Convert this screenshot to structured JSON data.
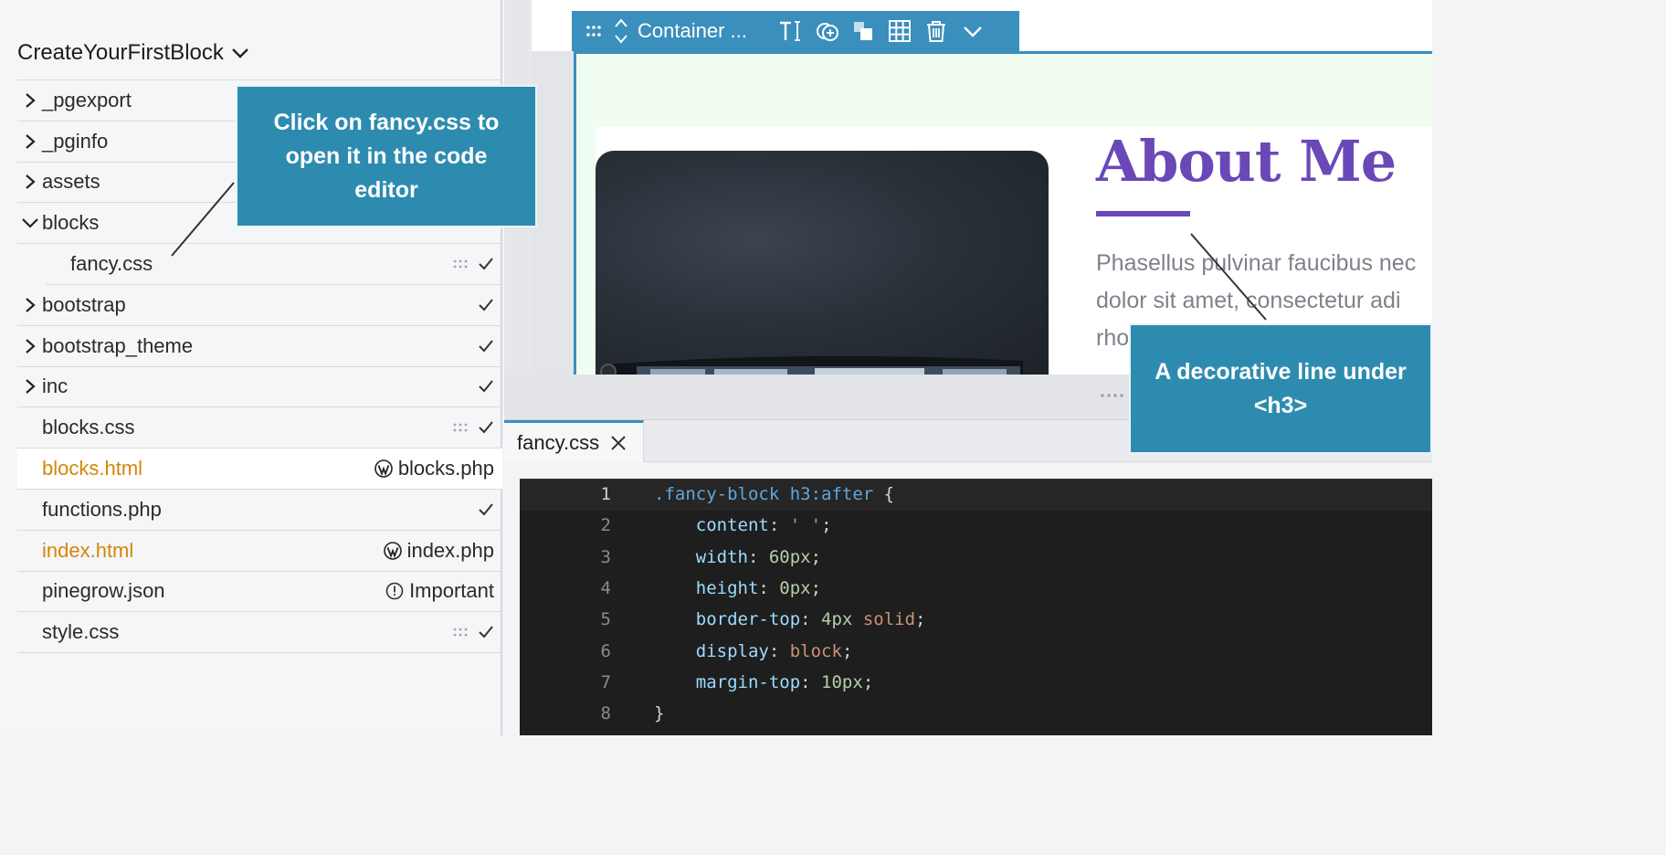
{
  "sidebar": {
    "project_title": "CreateYourFirstBlock",
    "items": [
      {
        "name": "_pgexport",
        "type": "folder",
        "expanded": false,
        "right": ""
      },
      {
        "name": "_pginfo",
        "type": "folder",
        "expanded": false,
        "right": ""
      },
      {
        "name": "assets",
        "type": "folder",
        "expanded": false,
        "right": ""
      },
      {
        "name": "blocks",
        "type": "folder",
        "expanded": true,
        "right": ""
      },
      {
        "name": "fancy.css",
        "type": "file",
        "child": true,
        "right": "check"
      },
      {
        "name": "bootstrap",
        "type": "folder",
        "expanded": false,
        "right": "check"
      },
      {
        "name": "bootstrap_theme",
        "type": "folder",
        "expanded": false,
        "right": "check"
      },
      {
        "name": "inc",
        "type": "folder",
        "expanded": false,
        "right": "check"
      },
      {
        "name": "blocks.css",
        "type": "file",
        "right": "check"
      },
      {
        "name": "blocks.html",
        "type": "file",
        "orange": true,
        "right_text": "blocks.php"
      },
      {
        "name": "functions.php",
        "type": "file",
        "right": "check"
      },
      {
        "name": "index.html",
        "type": "file",
        "orange": true,
        "right_text": "index.php"
      },
      {
        "name": "pinegrow.json",
        "type": "file",
        "right_text": "Important"
      },
      {
        "name": "style.css",
        "type": "file",
        "right": "check"
      }
    ]
  },
  "toolbar": {
    "label": "Container ..."
  },
  "preview": {
    "heading": "About Me",
    "paragraph_lines": [
      "Phasellus pulvinar faucibus nec",
      "dolor sit amet, consectetur adi",
      "rhoncus"
    ]
  },
  "editor": {
    "tab_label": "fancy.css",
    "lines": [
      {
        "n": "1"
      },
      {
        "n": "2"
      },
      {
        "n": "3"
      },
      {
        "n": "4"
      },
      {
        "n": "5"
      },
      {
        "n": "6"
      },
      {
        "n": "7"
      },
      {
        "n": "8"
      }
    ],
    "code": {
      "l1_sel": ".fancy-block h3:after",
      "l1_brace": " {",
      "l2_prop": "content",
      "l2_val": "' '",
      "l3_prop": "width",
      "l3_val": "60px",
      "l4_prop": "height",
      "l4_val": "0px",
      "l5_prop": "border-top",
      "l5_val1": "4px",
      "l5_val2": "solid",
      "l6_prop": "display",
      "l6_val": "block",
      "l7_prop": "margin-top",
      "l7_val": "10px",
      "l8_brace": "}"
    }
  },
  "callouts": {
    "first": "Click on fancy.css to open it in the code editor",
    "second": "A decorative line under <h3>"
  },
  "colors": {
    "accent": "#3a8fbd",
    "callout": "#2e8bb0",
    "heading": "#6a48b8",
    "orange_file": "#d4860b"
  }
}
